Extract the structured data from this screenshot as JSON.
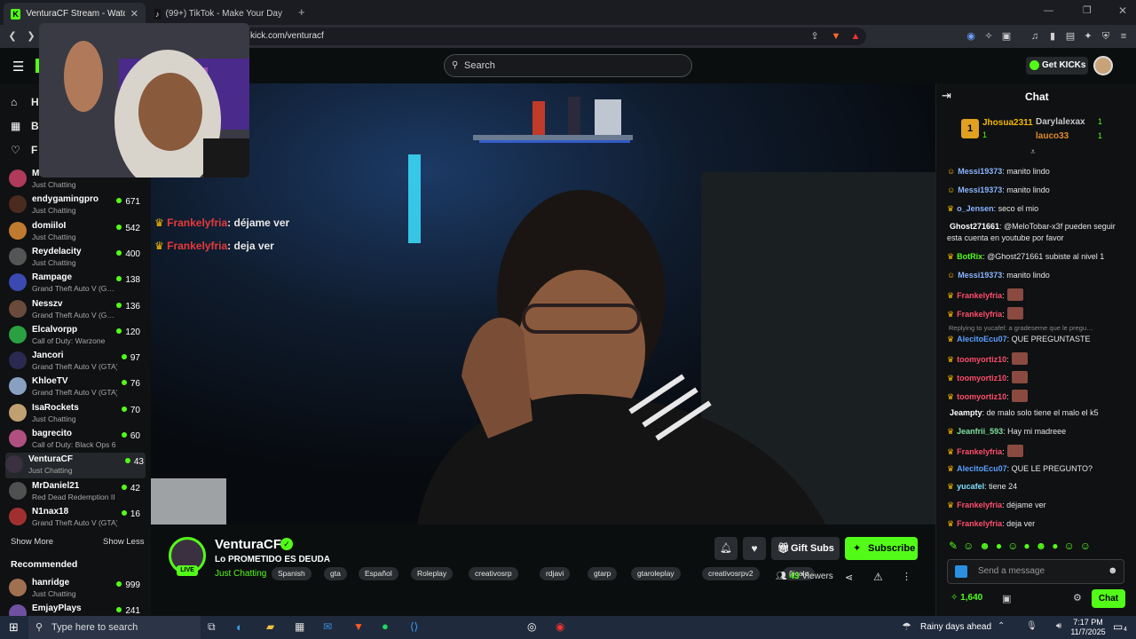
{
  "browser": {
    "tabs": [
      {
        "title": "VenturaCF Stream - Watch Live o",
        "active": true
      },
      {
        "title": "(99+) TikTok - Make Your Day",
        "active": false
      }
    ],
    "url": "kick.com/venturacf"
  },
  "header": {
    "search_placeholder": "Search",
    "get_kicks_label": "Get KICKs"
  },
  "sidebar": {
    "nav_partial": [
      "H",
      "B",
      "F"
    ],
    "channels": [
      {
        "name": "Mi",
        "category": "Just Chatting",
        "viewers": "",
        "color": "#b03a5a"
      },
      {
        "name": "endygamingpro",
        "category": "Just Chatting",
        "viewers": "671",
        "color": "#4b2a20"
      },
      {
        "name": "domiiloI",
        "category": "Just Chatting",
        "viewers": "542",
        "color": "#c07a30"
      },
      {
        "name": "Reydelacity",
        "category": "Just Chatting",
        "viewers": "400",
        "color": "#555"
      },
      {
        "name": "Rampage",
        "category": "Grand Theft Auto V (G…",
        "viewers": "138",
        "color": "#3a4ab0"
      },
      {
        "name": "Nesszv",
        "category": "Grand Theft Auto V (G…",
        "viewers": "136",
        "color": "#6a4a3a"
      },
      {
        "name": "Elcalvorpp",
        "category": "Call of Duty: Warzone",
        "viewers": "120",
        "color": "#2aa040"
      },
      {
        "name": "Jancori",
        "category": "Grand Theft Auto V (GTA)",
        "viewers": "97",
        "color": "#2a2a50"
      },
      {
        "name": "KhloeTV",
        "category": "Grand Theft Auto V (GTA)",
        "viewers": "76",
        "color": "#8aa0c0"
      },
      {
        "name": "IsaRockets",
        "category": "Just Chatting",
        "viewers": "70",
        "color": "#c0a070"
      },
      {
        "name": "bagrecito",
        "category": "Call of Duty: Black Ops 6",
        "viewers": "60",
        "color": "#b05080"
      },
      {
        "name": "VenturaCF",
        "category": "Just Chatting",
        "viewers": "43",
        "color": "#3a3040"
      },
      {
        "name": "MrDaniel21",
        "category": "Red Dead Redemption II",
        "viewers": "42",
        "color": "#505050"
      },
      {
        "name": "N1nax18",
        "category": "Grand Theft Auto V (GTA)",
        "viewers": "16",
        "color": "#a03030"
      }
    ],
    "show_more": "Show More",
    "show_less": "Show Less",
    "recommended_title": "Recommended",
    "recommended": [
      {
        "name": "hanridge",
        "category": "Just Chatting",
        "viewers": "999",
        "color": "#a07050"
      },
      {
        "name": "EmjayPlays",
        "category": "",
        "viewers": "241",
        "color": "#7050a0"
      }
    ]
  },
  "overlay_chat": [
    {
      "user": "Frankelyfria",
      "text": ": déjame ver"
    },
    {
      "user": "Frankelyfria",
      "text": ": deja ver"
    }
  ],
  "stream": {
    "channel_name": "VenturaCF",
    "live_badge": "LIVE",
    "title": "Lo PROMETIDO ES DEUDA",
    "category": "Just Chatting",
    "tags": [
      "Spanish",
      "gta",
      "Español",
      "Roleplay",
      "creativosrp",
      "rdjavi",
      "gtarp",
      "gtaroleplay",
      "creativosrpv2",
      "ñicalo"
    ],
    "gift_subs_label": "Gift Subs",
    "subscribe_label": "Subscribe",
    "viewers_count": "43",
    "viewers_label": "Viewers"
  },
  "chat": {
    "title": "Chat",
    "top_gifters": [
      {
        "name": "Jhosua2311",
        "count": "1"
      },
      {
        "name": "Darylalexax",
        "count": "1"
      },
      {
        "name": "lauco33",
        "count": "1"
      }
    ],
    "messages": [
      {
        "user": "Messi19373",
        "text": ": manito lindo",
        "color": "#8ab4ff"
      },
      {
        "user": "Messi19373",
        "text": ": manito lindo",
        "color": "#8ab4ff"
      },
      {
        "user": "o_Jensen",
        "text": ": seco el mio",
        "color": "#8ab4ff"
      },
      {
        "user": "Ghost271661",
        "text": ": @MeloTobar-x3f pueden seguir esta cuenta en youtube por favor",
        "color": "#ffffff"
      },
      {
        "user": "BotRix",
        "text": ": @Ghost271661 subiste al nivel 1",
        "color": "#53fc18"
      },
      {
        "user": "Messi19373",
        "text": ": manito lindo",
        "color": "#8ab4ff"
      },
      {
        "user": "Frankelyfria",
        "text": ":",
        "color": "#ff4d6d"
      },
      {
        "user": "Frankelyfria",
        "text": ":",
        "color": "#ff4d6d"
      },
      {
        "user": "AlecitoEcu07",
        "text": ": QUE PREGUNTASTE",
        "color": "#5aa0ff"
      },
      {
        "user": "toomyortiz10",
        "text": ":",
        "color": "#ff4d6d"
      },
      {
        "user": "toomyortiz10",
        "text": ":",
        "color": "#ff4d6d"
      },
      {
        "user": "toomyortiz10",
        "text": ":",
        "color": "#ff4d6d"
      },
      {
        "user": "Jeampty",
        "text": ": de malo solo tiene el malo el k5",
        "color": "#ffffff"
      },
      {
        "user": "Jeanfrii_593",
        "text": ": Hay mi madreee",
        "color": "#7fe0a0"
      },
      {
        "user": "Frankelyfria",
        "text": ":",
        "color": "#ff4d6d"
      },
      {
        "user": "AlecitoEcu07",
        "text": ": QUE LE PREGUNTO?",
        "color": "#5aa0ff"
      },
      {
        "user": "yucafel",
        "text": ": tiene 24",
        "color": "#7fe0ff"
      },
      {
        "user": "Frankelyfria",
        "text": ": déjame ver",
        "color": "#ff4d6d"
      },
      {
        "user": "Frankelyfria",
        "text": ": deja ver",
        "color": "#ff4d6d"
      }
    ],
    "reply_hint": "Replying to yucafel: a gradeseme que le pregu…",
    "input_placeholder": "Send a message",
    "points": "1,640",
    "chat_button": "Chat"
  },
  "taskbar": {
    "search_placeholder": "Type here to search",
    "weather": "Rainy days ahead",
    "time": "7:17 PM",
    "date": "11/7/2025",
    "notifications": "4"
  }
}
